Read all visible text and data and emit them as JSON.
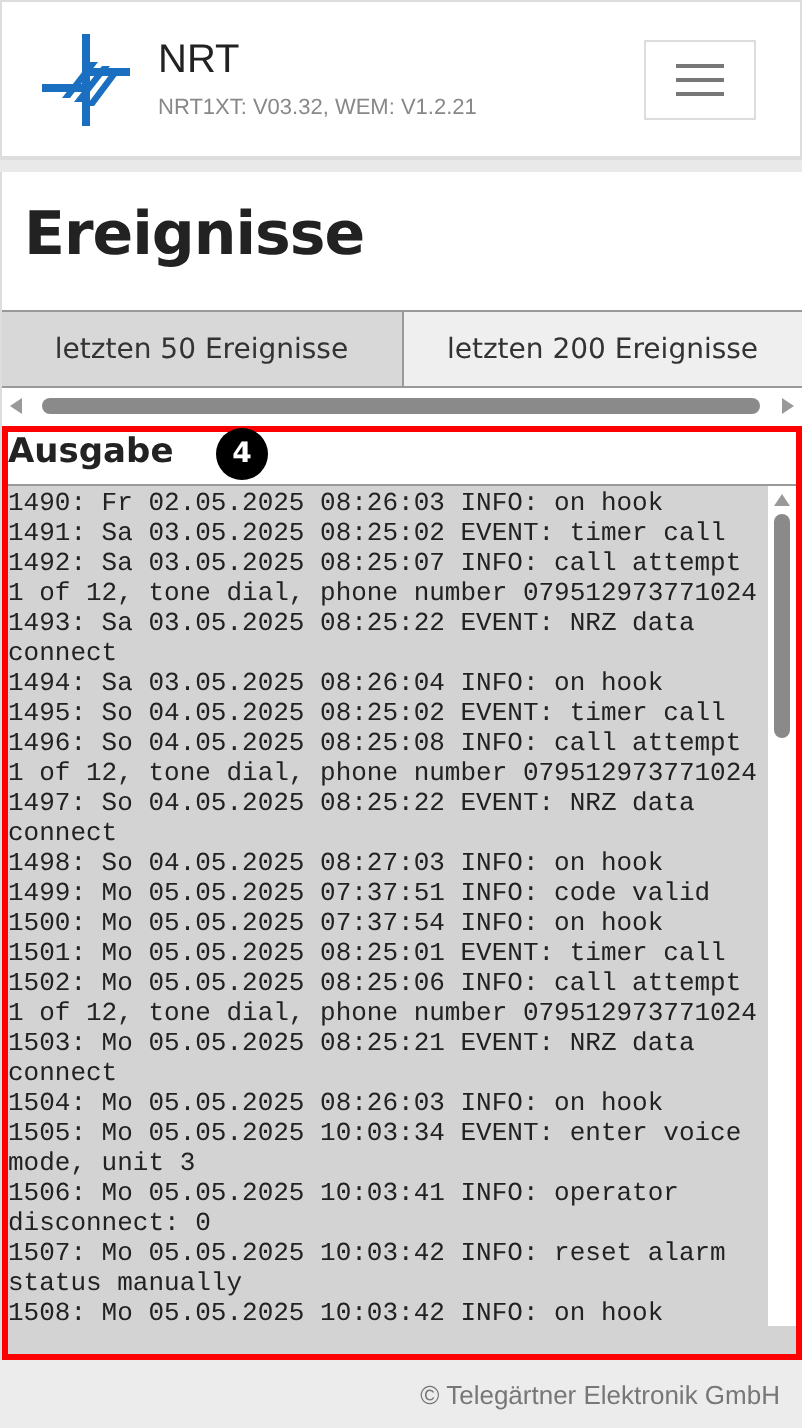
{
  "header": {
    "title": "NRT",
    "version": "NRT1XT: V03.32, WEM: V1.2.21"
  },
  "page_title": "Ereignisse",
  "tabs": [
    {
      "label": "letzten 50 Ereignisse",
      "selected": true
    },
    {
      "label": "letzten 200 Ereignisse",
      "selected": false
    }
  ],
  "output": {
    "label": "Ausgabe",
    "annotation": "4",
    "log": [
      "1490: Fr 02.05.2025 08:26:03 INFO: on hook",
      "1491: Sa 03.05.2025 08:25:02 EVENT: timer call",
      "1492: Sa 03.05.2025 08:25:07 INFO: call attempt 1 of 12, tone dial, phone number 079512973771024",
      "1493: Sa 03.05.2025 08:25:22 EVENT: NRZ data connect",
      "1494: Sa 03.05.2025 08:26:04 INFO: on hook",
      "1495: So 04.05.2025 08:25:02 EVENT: timer call",
      "1496: So 04.05.2025 08:25:08 INFO: call attempt 1 of 12, tone dial, phone number 079512973771024",
      "1497: So 04.05.2025 08:25:22 EVENT: NRZ data connect",
      "1498: So 04.05.2025 08:27:03 INFO: on hook",
      "1499: Mo 05.05.2025 07:37:51 INFO: code valid",
      "1500: Mo 05.05.2025 07:37:54 INFO: on hook",
      "1501: Mo 05.05.2025 08:25:01 EVENT: timer call",
      "1502: Mo 05.05.2025 08:25:06 INFO: call attempt 1 of 12, tone dial, phone number 079512973771024",
      "1503: Mo 05.05.2025 08:25:21 EVENT: NRZ data connect",
      "1504: Mo 05.05.2025 08:26:03 INFO: on hook",
      "1505: Mo 05.05.2025 10:03:34 EVENT: enter voice mode, unit 3",
      "1506: Mo 05.05.2025 10:03:41 INFO: operator disconnect: 0",
      "1507: Mo 05.05.2025 10:03:42 INFO: reset alarm status manually",
      "1508: Mo 05.05.2025 10:03:42 INFO: on hook"
    ]
  },
  "footer": "© Telegärtner Elektronik GmbH"
}
